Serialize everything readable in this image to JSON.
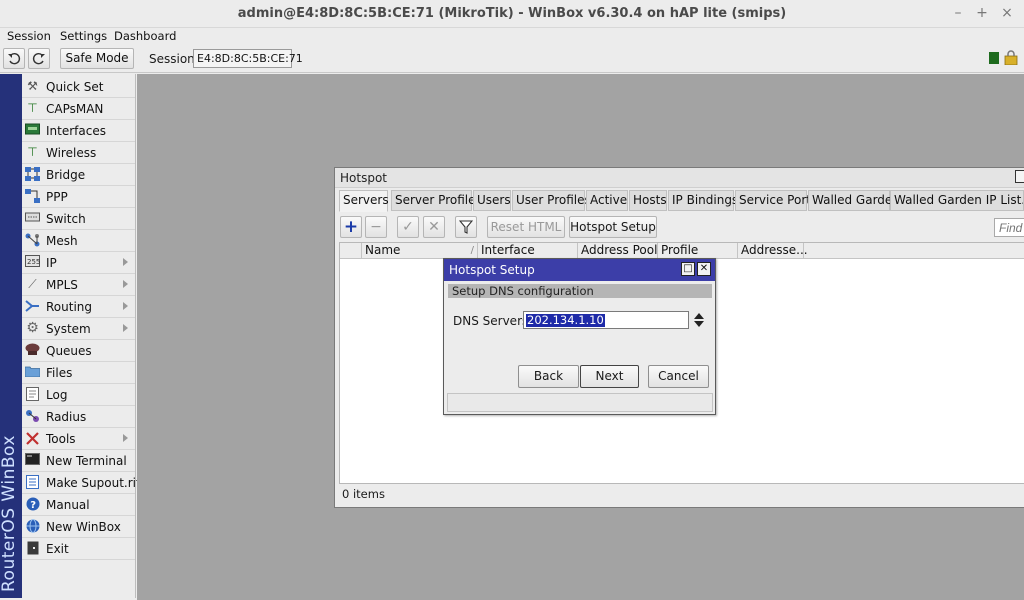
{
  "window": {
    "title": "admin@E4:8D:8C:5B:CE:71 (MikroTik) - WinBox v6.30.4 on hAP lite (smips)",
    "minimize": "–",
    "maximize": "+",
    "close": "×"
  },
  "menubar": {
    "items": [
      "Session",
      "Settings",
      "Dashboard"
    ]
  },
  "toolbar": {
    "undo_icon": "undo-icon",
    "redo_icon": "redo-icon",
    "safe_mode_label": "Safe Mode",
    "session_label": "Session:",
    "session_value": "E4:8D:8C:5B:CE:71"
  },
  "sidebar": {
    "brand": "RouterOS WinBox",
    "items": [
      {
        "label": "Quick Set",
        "icon": "wand-icon",
        "submenu": false
      },
      {
        "label": "CAPsMAN",
        "icon": "antenna-icon",
        "submenu": false
      },
      {
        "label": "Interfaces",
        "icon": "interfaces-icon",
        "submenu": false
      },
      {
        "label": "Wireless",
        "icon": "wireless-icon",
        "submenu": false
      },
      {
        "label": "Bridge",
        "icon": "bridge-icon",
        "submenu": false
      },
      {
        "label": "PPP",
        "icon": "ppp-icon",
        "submenu": false
      },
      {
        "label": "Switch",
        "icon": "switch-icon",
        "submenu": false
      },
      {
        "label": "Mesh",
        "icon": "mesh-icon",
        "submenu": false
      },
      {
        "label": "IP",
        "icon": "ip-icon",
        "submenu": true
      },
      {
        "label": "MPLS",
        "icon": "mpls-icon",
        "submenu": true
      },
      {
        "label": "Routing",
        "icon": "routing-icon",
        "submenu": true
      },
      {
        "label": "System",
        "icon": "gear-icon",
        "submenu": true
      },
      {
        "label": "Queues",
        "icon": "queues-icon",
        "submenu": false
      },
      {
        "label": "Files",
        "icon": "folder-icon",
        "submenu": false
      },
      {
        "label": "Log",
        "icon": "log-icon",
        "submenu": false
      },
      {
        "label": "Radius",
        "icon": "radius-icon",
        "submenu": false
      },
      {
        "label": "Tools",
        "icon": "tools-icon",
        "submenu": true
      },
      {
        "label": "New Terminal",
        "icon": "terminal-icon",
        "submenu": false
      },
      {
        "label": "Make Supout.rif",
        "icon": "document-icon",
        "submenu": false
      },
      {
        "label": "Manual",
        "icon": "help-icon",
        "submenu": false
      },
      {
        "label": "New WinBox",
        "icon": "globe-icon",
        "submenu": false
      },
      {
        "label": "Exit",
        "icon": "exit-icon",
        "submenu": false
      }
    ]
  },
  "hotspot": {
    "title": "Hotspot",
    "tabs": [
      "Servers",
      "Server Profiles",
      "Users",
      "User Profiles",
      "Active",
      "Hosts",
      "IP Bindings",
      "Service Ports",
      "Walled Garden",
      "Walled Garden IP List..."
    ],
    "active_tab": "Servers",
    "add": "+",
    "remove": "−",
    "enable": "✓",
    "disable": "✕",
    "reset_html": "Reset HTML",
    "hotspot_setup": "Hotspot Setup",
    "find_placeholder": "Find",
    "columns": [
      "",
      "Name",
      "Interface",
      "Address Pool",
      "Profile",
      "Addresse..."
    ],
    "sort_indicator": "/",
    "item_count": "0 items"
  },
  "setup_dialog": {
    "title": "Hotspot Setup",
    "step": "Setup DNS configuration",
    "dns_label": "DNS Servers",
    "dns_value": "202.134.1.10",
    "back": "Back",
    "next": "Next",
    "cancel": "Cancel",
    "restore": "□",
    "close": "✕"
  },
  "colors": {
    "brand_bar": "#25317a",
    "dialog_title": "#3c3ea8",
    "workspace": "#a3a3a3",
    "add_button": "#1a3aa8"
  }
}
